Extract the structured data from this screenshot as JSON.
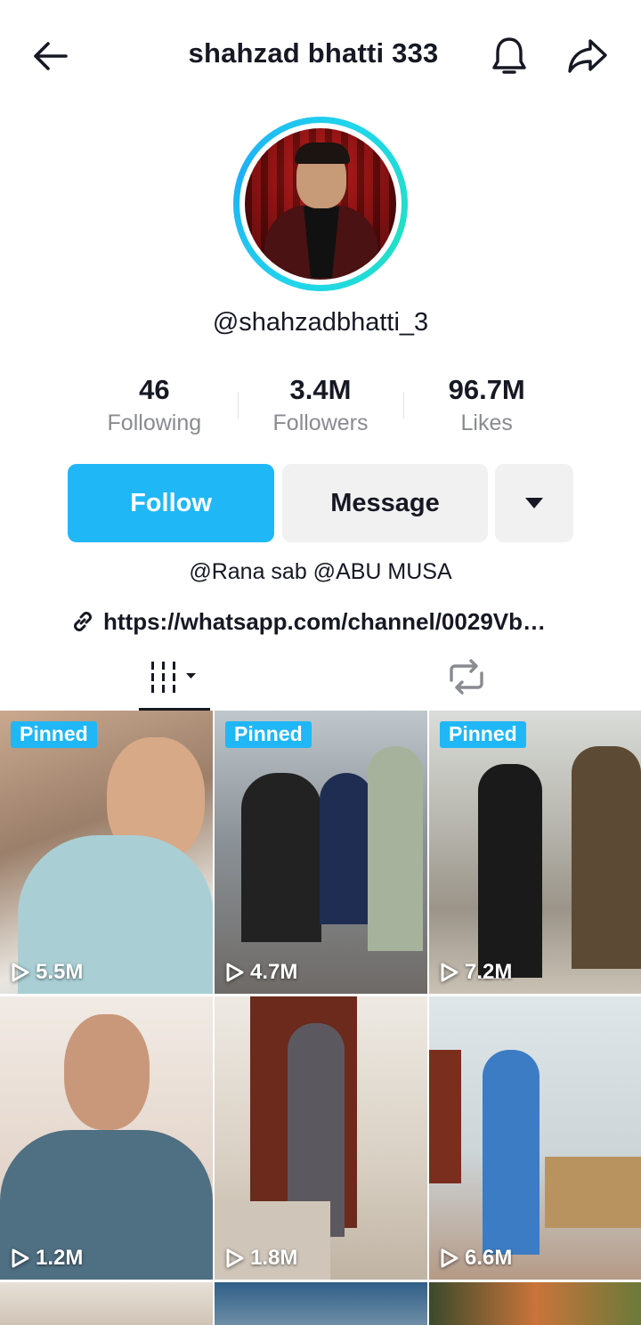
{
  "header": {
    "title": "shahzad bhatti 333"
  },
  "profile": {
    "handle": "@shahzadbhatti_3",
    "stats": [
      {
        "value": "46",
        "label": "Following"
      },
      {
        "value": "3.4M",
        "label": "Followers"
      },
      {
        "value": "96.7M",
        "label": "Likes"
      }
    ],
    "follow_label": "Follow",
    "message_label": "Message",
    "bio": "@Rana sab @ABU MUSA",
    "link": "https://whatsapp.com/channel/0029Vb…"
  },
  "tabs": [
    {
      "name": "videos",
      "icon": "grid-icon",
      "active": true
    },
    {
      "name": "reposts",
      "icon": "repost-icon",
      "active": false
    }
  ],
  "videos": [
    {
      "pinned": "Pinned",
      "views": "5.5M"
    },
    {
      "pinned": "Pinned",
      "views": "4.7M"
    },
    {
      "pinned": "Pinned",
      "views": "7.2M"
    },
    {
      "pinned": "",
      "views": "1.2M"
    },
    {
      "pinned": "",
      "views": "1.8M"
    },
    {
      "pinned": "",
      "views": "6.6M"
    }
  ],
  "colors": {
    "accent": "#20b7f6",
    "text": "#161823",
    "muted": "#8a8b91",
    "button_gray": "#f1f1f2",
    "ring": "#20d5ec"
  }
}
